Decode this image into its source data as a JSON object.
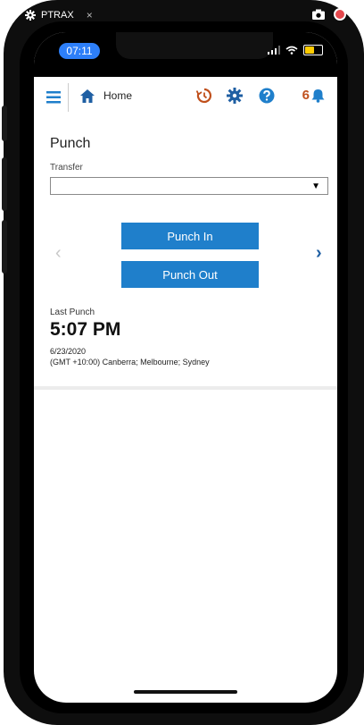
{
  "capture": {
    "app_name": "PTRAX",
    "close_symbol": "×"
  },
  "status": {
    "time": "07:11",
    "battery_level": 0.55
  },
  "header": {
    "home_label": "Home",
    "notification_count": "6"
  },
  "punch": {
    "title": "Punch",
    "transfer_label": "Transfer",
    "transfer_value": "",
    "punch_in_label": "Punch In",
    "punch_out_label": "Punch Out",
    "prev_arrow": "‹",
    "next_arrow": "›"
  },
  "last_punch": {
    "label": "Last Punch",
    "time": "5:07 PM",
    "date": "6/23/2020",
    "timezone": "(GMT +10:00) Canberra; Melbourne; Sydney"
  },
  "colors": {
    "primary_blue": "#1f7fcb",
    "accent_orange": "#c0501c",
    "time_pill": "#2d7ff9"
  }
}
